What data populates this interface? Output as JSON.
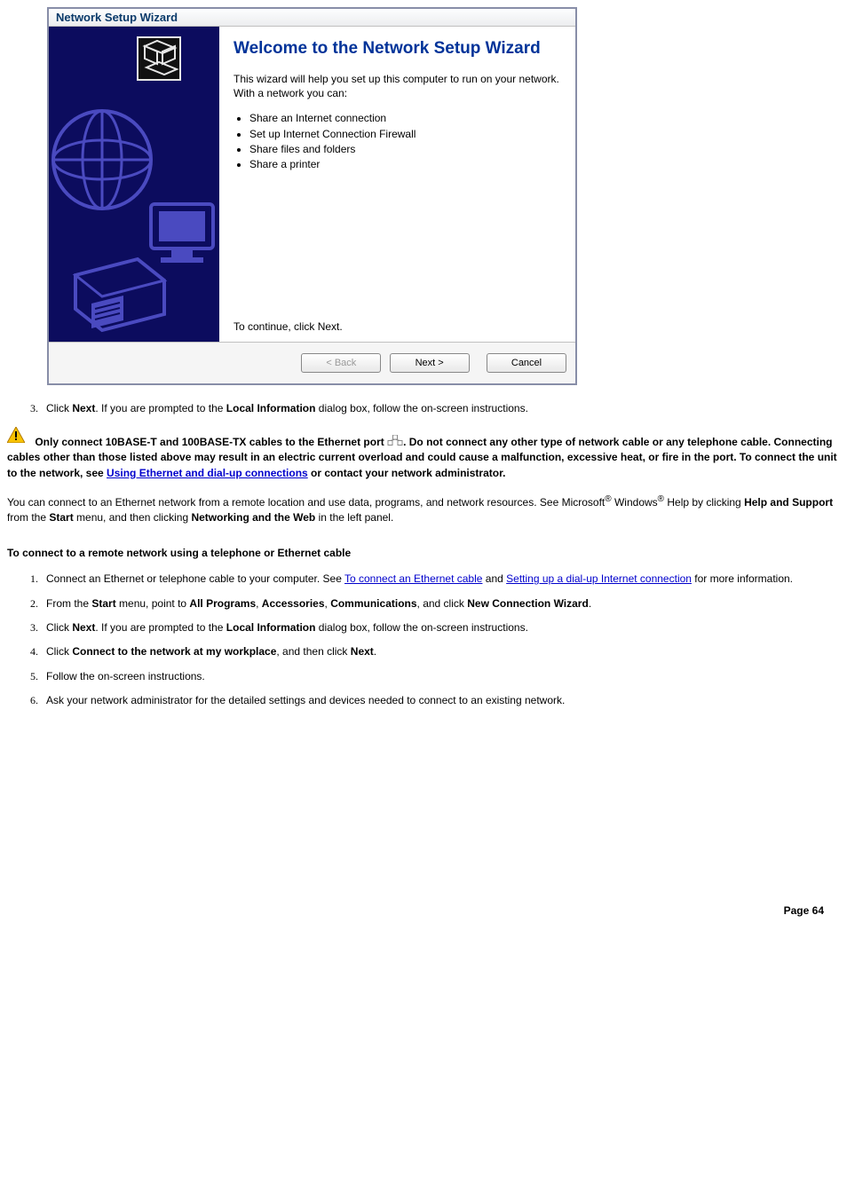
{
  "wizard": {
    "title": "Network Setup Wizard",
    "heading": "Welcome to the Network Setup Wizard",
    "intro": "This wizard will help you set up this computer to run on your network. With a network you can:",
    "bullets": [
      "Share an Internet connection",
      "Set up Internet Connection Firewall",
      "Share files and folders",
      "Share a printer"
    ],
    "continue": "To continue, click Next.",
    "buttons": {
      "back": "< Back",
      "next": "Next >",
      "cancel": "Cancel"
    }
  },
  "step3": {
    "num": "3.",
    "pre": "Click ",
    "bold1": "Next",
    "mid1": ". If you are prompted to the ",
    "bold2": "Local Information",
    "post": " dialog box, follow the on-screen instructions."
  },
  "caution": {
    "a": "Only connect 10BASE-T and 100BASE-TX cables to the Ethernet port ",
    "b": ". Do not connect any other type of network cable or any telephone cable. Connecting cables other than those listed above may result in an electric current overload and could cause a malfunction, excessive heat, or fire in the port. To connect the unit to the network, see ",
    "link": "Using Ethernet and dial-up connections",
    "c": " or contact your network administrator."
  },
  "para": {
    "a": "You can connect to an Ethernet network from a remote location and use data, programs, and network resources. See Microsoft",
    "b": " Windows",
    "c": " Help by clicking ",
    "bold1": "Help and Support",
    "d": " from the ",
    "bold2": "Start",
    "e": " menu, and then clicking ",
    "bold3": "Networking and the Web",
    "f": " in the left panel."
  },
  "subhead": "To connect to a remote network using a telephone or Ethernet cable",
  "list2": {
    "i1": {
      "a": "Connect an Ethernet or telephone cable to your computer. See ",
      "link1": "To connect an Ethernet cable",
      "b": " and ",
      "link2": "Setting up a dial-up Internet connection",
      "c": " for more information."
    },
    "i2": {
      "a": "From the ",
      "b1": "Start",
      "b": " menu, point to ",
      "b2": "All Programs",
      "c": ", ",
      "b3": "Accessories",
      "d": ", ",
      "b4": "Communications",
      "e": ", and click ",
      "b5": "New Connection Wizard",
      "f": "."
    },
    "i3": {
      "a": "Click ",
      "b1": "Next",
      "b": ". If you are prompted to the ",
      "b2": "Local Information",
      "c": " dialog box, follow the on-screen instructions."
    },
    "i4": {
      "a": "Click ",
      "b1": "Connect to the network at my workplace",
      "b": ", and then click ",
      "b2": "Next",
      "c": "."
    },
    "i5": "Follow the on-screen instructions.",
    "i6": "Ask your network administrator for the detailed settings and devices needed to connect to an existing network."
  },
  "footer": "Page 64"
}
